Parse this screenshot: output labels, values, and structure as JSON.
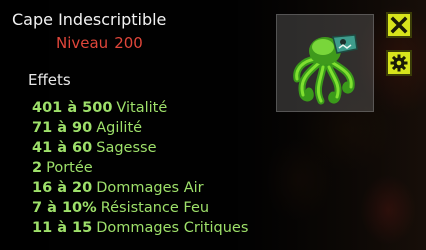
{
  "item": {
    "name": "Cape Indescriptible",
    "level_label": "Niveau",
    "level_value": "200"
  },
  "effects": {
    "heading": "Effets",
    "items": [
      {
        "value": "401 à 500",
        "name": "Vitalité"
      },
      {
        "value": "71 à 90",
        "name": "Agilité"
      },
      {
        "value": "41 à 60",
        "name": "Sagesse"
      },
      {
        "value": "2",
        "name": "Portée"
      },
      {
        "value": "16 à 20",
        "name": "Dommages Air"
      },
      {
        "value": "7 à 10%",
        "name": "Résistance Feu"
      },
      {
        "value": "11 à 15",
        "name": "Dommages Critiques"
      }
    ]
  },
  "controls": {
    "close_icon": "close-icon",
    "settings_icon": "gear-icon"
  },
  "colors": {
    "title": "#f2f2f2",
    "level": "#e0463a",
    "effect": "#9ee06a",
    "button": "#d7e41c"
  }
}
